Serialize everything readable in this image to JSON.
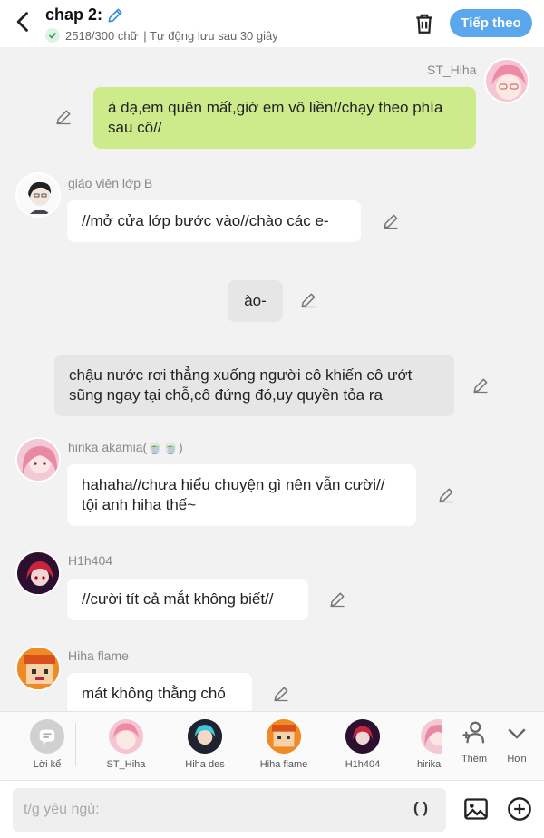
{
  "header": {
    "title": "chap 2:",
    "word_count": "2518/300 chữ",
    "autosave": "| Tự động lưu sau 30 giây",
    "next_label": "Tiếp theo"
  },
  "messages": [
    {
      "sender": "ST_Hiha",
      "text": "à dạ,em quên mất,giờ em vô liền//chạy theo phía sau cô//"
    },
    {
      "sender": "giáo viên lớp B",
      "text": "//mở cửa lớp bước vào//chào các e-"
    },
    {
      "text": "ào-"
    },
    {
      "text": "chậu nước rơi thẳng xuống người cô khiến cô ướt sũng ngay tại chỗ,cô đứng đó,uy quyền tỏa ra"
    },
    {
      "sender": "hirika akamia(🍵🍵)",
      "text": "hahaha//chưa hiểu chuyện gì nên vẫn cười// tội anh hiha thế~"
    },
    {
      "sender": "H1h404",
      "text": "//cười tít cả mắt không biết//"
    },
    {
      "sender": "Hiha flame",
      "text": "mát không thằng chó"
    }
  ],
  "charbar": {
    "narrator": "Lời kể",
    "characters": [
      "ST_Hiha",
      "Hiha des",
      "Hiha flame",
      "H1h404",
      "hirika"
    ],
    "more_label": "Thêm",
    "down_label": "Hơn"
  },
  "input": {
    "placeholder": "t/g yêu ngủ:",
    "paren": "( )"
  },
  "colors": {
    "accent": "#5aa7ee",
    "own_bubble": "#cdeb8b",
    "narration_bubble": "#e6e6e6"
  }
}
